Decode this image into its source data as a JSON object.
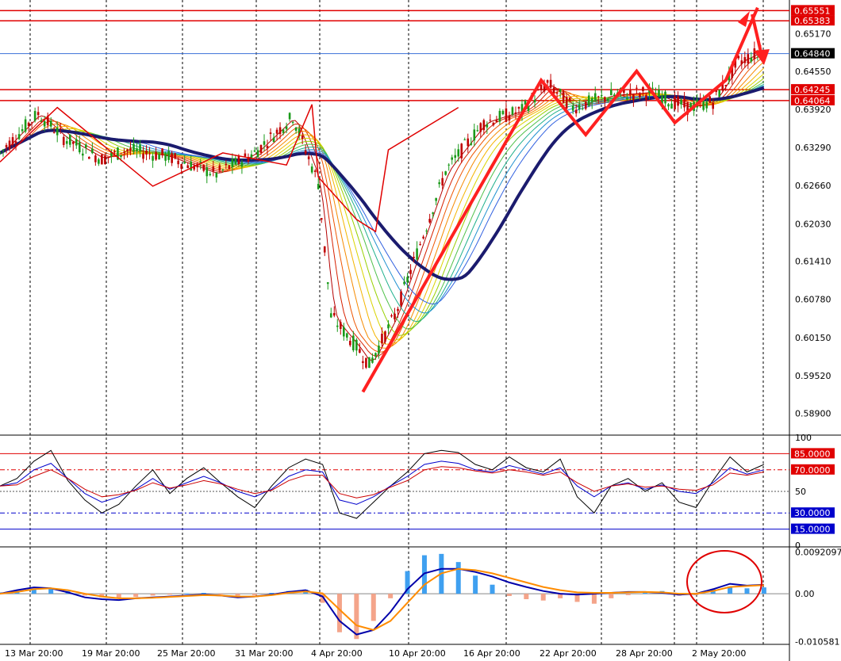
{
  "chart_data": [
    {
      "type": "candlestick",
      "panel": "price",
      "price_ticks": [
        "0.65170",
        "0.64550",
        "0.63920",
        "0.63290",
        "0.62660",
        "0.62030",
        "0.61410",
        "0.60780",
        "0.60150",
        "0.59520",
        "0.58900"
      ],
      "ylim": [
        0.5855,
        0.657
      ],
      "current_price": "0.64840",
      "level_tags": [
        "0.65551",
        "0.65383",
        "0.64245",
        "0.64064"
      ],
      "time_labels": [
        "13 Mar 20:00",
        "19 Mar 20:00",
        "25 Mar 20:00",
        "31 Mar 20:00",
        "4 Apr 20:00",
        "10 Apr 20:00",
        "16 Apr 20:00",
        "22 Apr 20:00",
        "28 Apr 20:00",
        "2 May 20:00"
      ],
      "close_path": [
        {
          "t": 0,
          "y": 0.632
        },
        {
          "t": 3,
          "y": 0.6385
        },
        {
          "t": 5,
          "y": 0.6345
        },
        {
          "t": 8,
          "y": 0.631
        },
        {
          "t": 10,
          "y": 0.6325
        },
        {
          "t": 13,
          "y": 0.6315
        },
        {
          "t": 17,
          "y": 0.6285
        },
        {
          "t": 20,
          "y": 0.632
        },
        {
          "t": 23,
          "y": 0.638
        },
        {
          "t": 25,
          "y": 0.627
        },
        {
          "t": 26,
          "y": 0.605
        },
        {
          "t": 28,
          "y": 0.6
        },
        {
          "t": 29,
          "y": 0.597
        },
        {
          "t": 31,
          "y": 0.605
        },
        {
          "t": 33,
          "y": 0.617
        },
        {
          "t": 35,
          "y": 0.629
        },
        {
          "t": 38,
          "y": 0.637
        },
        {
          "t": 41,
          "y": 0.639
        },
        {
          "t": 43,
          "y": 0.6435
        },
        {
          "t": 45,
          "y": 0.6395
        },
        {
          "t": 48,
          "y": 0.6415
        },
        {
          "t": 51,
          "y": 0.642
        },
        {
          "t": 54,
          "y": 0.6395
        },
        {
          "t": 56,
          "y": 0.6405
        },
        {
          "t": 58,
          "y": 0.647
        },
        {
          "t": 60,
          "y": 0.649
        }
      ],
      "annotations": [
        "zigzag-lines",
        "moving-average-ribbon",
        "up-arrow",
        "down-arrow"
      ]
    },
    {
      "type": "line",
      "panel": "oscillator",
      "ylim": [
        0,
        100
      ],
      "axis_labels": [
        "100",
        "50",
        "0"
      ],
      "levels": [
        "85.0000",
        "70.0000",
        "30.0000",
        "15.0000"
      ],
      "series": [
        {
          "color": "#000000",
          "values": [
            55,
            62,
            78,
            88,
            60,
            42,
            30,
            38,
            55,
            70,
            48,
            62,
            72,
            58,
            45,
            35,
            55,
            72,
            80,
            75,
            30,
            25,
            40,
            55,
            68,
            85,
            88,
            86,
            75,
            70,
            82,
            72,
            68,
            80,
            45,
            30,
            55,
            62,
            50,
            58,
            40,
            35,
            60,
            82,
            68,
            75
          ]
        },
        {
          "color": "#0000cc",
          "values": [
            55,
            58,
            70,
            76,
            62,
            48,
            40,
            45,
            52,
            62,
            52,
            58,
            64,
            58,
            50,
            45,
            52,
            64,
            70,
            68,
            42,
            38,
            45,
            55,
            64,
            75,
            78,
            76,
            70,
            68,
            74,
            70,
            66,
            72,
            55,
            45,
            55,
            58,
            52,
            56,
            50,
            48,
            58,
            72,
            66,
            70
          ]
        },
        {
          "color": "#cc0000",
          "values": [
            55,
            56,
            64,
            70,
            62,
            52,
            45,
            47,
            51,
            58,
            53,
            56,
            60,
            57,
            52,
            48,
            51,
            60,
            65,
            65,
            48,
            44,
            47,
            54,
            60,
            70,
            73,
            72,
            69,
            67,
            70,
            68,
            65,
            68,
            58,
            50,
            55,
            57,
            54,
            55,
            52,
            51,
            56,
            67,
            65,
            68
          ]
        }
      ]
    },
    {
      "type": "histogram",
      "panel": "macd",
      "axis_labels": [
        "0.0092097",
        "0.00",
        "-0.010581"
      ],
      "ylim": [
        -0.011,
        0.01
      ],
      "series": [
        {
          "name": "histogram",
          "values": [
            0.0003,
            0.0006,
            0.0009,
            0.0012,
            0.0006,
            -0.0004,
            -0.0008,
            -0.001,
            -0.0007,
            -0.0004,
            -0.0002,
            0.0001,
            0.0002,
            -0.0001,
            -0.0004,
            -0.0003,
            0.0002,
            0.0006,
            0.0009,
            -0.002,
            -0.0085,
            -0.01,
            -0.006,
            -0.001,
            0.005,
            0.0085,
            0.0088,
            0.007,
            0.004,
            0.002,
            -0.0005,
            -0.0012,
            -0.0015,
            -0.001,
            -0.0018,
            -0.0022,
            -0.001,
            -0.0003,
            0.0004,
            0.0006,
            -0.0004,
            -0.0003,
            0.001,
            0.0016,
            0.0012,
            0.0014
          ]
        },
        {
          "name": "macd",
          "color": "#0000aa",
          "values": [
            0.0,
            0.0008,
            0.0014,
            0.0012,
            0.0003,
            -0.0008,
            -0.0012,
            -0.0014,
            -0.001,
            -0.0008,
            -0.0006,
            -0.0004,
            -0.0002,
            -0.0004,
            -0.0008,
            -0.0006,
            -0.0002,
            0.0004,
            0.0008,
            -0.0006,
            -0.006,
            -0.009,
            -0.008,
            -0.004,
            0.001,
            0.0045,
            0.0055,
            0.0055,
            0.0048,
            0.0038,
            0.0025,
            0.0015,
            0.0006,
            0.0,
            -0.0002,
            0.0,
            0.0002,
            0.0004,
            0.0004,
            0.0002,
            -0.0002,
            0.0,
            0.001,
            0.0022,
            0.0018,
            0.002
          ]
        },
        {
          "name": "signal",
          "color": "#ff8c00",
          "values": [
            0.0,
            0.0004,
            0.001,
            0.0012,
            0.0008,
            0.0,
            -0.0006,
            -0.001,
            -0.001,
            -0.0009,
            -0.0007,
            -0.0005,
            -0.0003,
            -0.0004,
            -0.0006,
            -0.0006,
            -0.0003,
            0.0002,
            0.0005,
            0.0001,
            -0.0035,
            -0.007,
            -0.008,
            -0.006,
            -0.002,
            0.002,
            0.0045,
            0.0055,
            0.0052,
            0.0045,
            0.0035,
            0.0025,
            0.0015,
            0.0008,
            0.0003,
            0.0002,
            0.0002,
            0.0003,
            0.0004,
            0.0003,
            0.0,
            0.0,
            0.0006,
            0.0015,
            0.0017,
            0.0019
          ]
        }
      ]
    }
  ]
}
